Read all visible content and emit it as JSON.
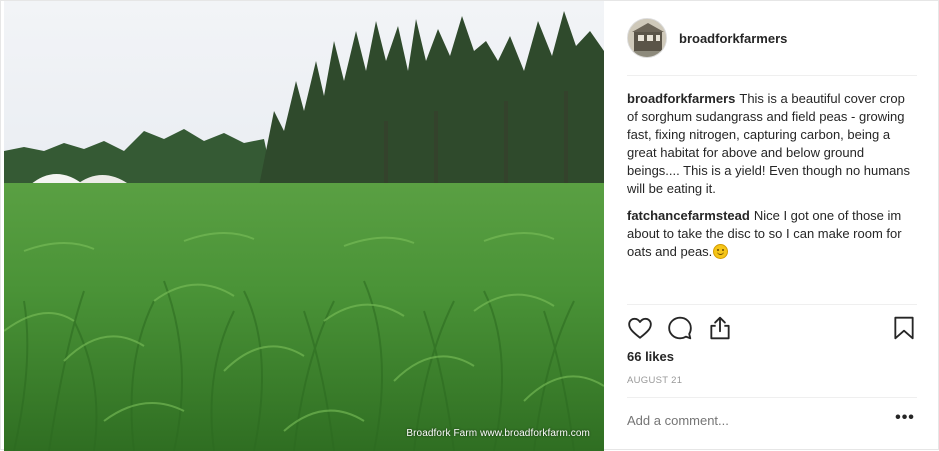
{
  "post": {
    "username": "broadforkfarmers",
    "photo_watermark": "Broadfork Farm www.broadforkfarm.com",
    "caption": {
      "author": "broadforkfarmers",
      "text": "This is a beautiful cover crop of sorghum sudangrass and field peas - growing fast, fixing nitrogen, capturing carbon, being a great habitat for above and below ground beings.... This is a yield! Even though no humans will be eating it."
    },
    "comments": [
      {
        "author": "fatchancefarmstead",
        "text": "Nice I got one of those im about to take the disc to so I can make room for oats and peas."
      }
    ],
    "likes": "66 likes",
    "date": "AUGUST 21",
    "add_comment_placeholder": "Add a comment...",
    "more_label": "•••"
  },
  "icons": {
    "like": "heart-icon",
    "comment": "comment-bubble-icon",
    "share": "share-upload-icon",
    "save": "bookmark-icon"
  },
  "colors": {
    "text": "#262626",
    "muted": "#999999",
    "divider": "#efefef",
    "sky": "#e6eaef",
    "grass": "#3f8e2f",
    "trees": "#2f4a2c"
  }
}
